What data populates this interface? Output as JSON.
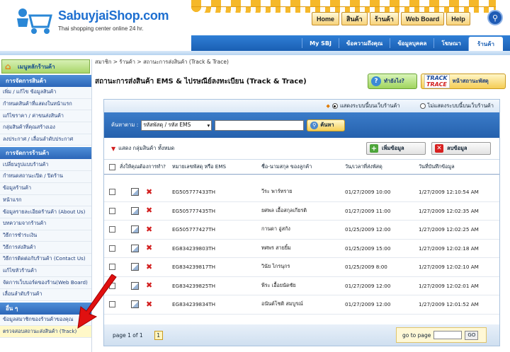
{
  "header": {
    "logo": "SabuyjaiShop.com",
    "tagline": "Thai shopping center online 24 hr.",
    "nav": [
      "Home",
      "สินค้า",
      "ร้านค้า",
      "Web Board",
      "Help"
    ],
    "bluebar": [
      "My SBJ",
      "ข้อความถึงคุณ",
      "ข้อมูลบุคคล",
      "โฆษณา",
      "ร้านค้า"
    ]
  },
  "sidebar": {
    "home": "เมนูหลักร้านค้า",
    "section1": "การจัดการสินค้า",
    "section1_items": [
      "เพิ่ม / แก้ไข ข้อมูลสินค้า",
      "กำหนดสินค้าที่แสดงในหน้าแรก",
      "แก้ไขราคา / ค่าขนส่งสินค้า",
      "กลุ่มสินค้าที่คุณสร้างเอง",
      "ลงประกาศ / เลื่อนลำดับประกาศ"
    ],
    "section2": "การจัดการร้านค้า",
    "section2_items": [
      "เปลี่ยนรูปแบบร้านค้า",
      "กำหนดสถานะเปิด / ปิดร้าน",
      "ข้อมูลร้านค้า",
      "หน้าแรก",
      "ข้อมูลรายละเอียดร้านค้า (About Us)",
      "บทความจากร้านค้า",
      "วิธีการชำระเงิน",
      "วิธีการส่งสินค้า",
      "วิธีการติดต่อกับร้านค้า (Contact Us)",
      "แก้ไขหัวร้านค้า",
      "จัดการเว็บบอร์ดของร้าน(Web Board)",
      "เลื่อนลำดับร้านค้า"
    ],
    "section3": "อื่น ๆ",
    "section3_items": [
      "ข้อมูลสมาชิกของร้านค้าของคุณ",
      "ตรวจสอบสถานะส่งสินค้า (Track)"
    ]
  },
  "main": {
    "breadcrumb": "สมาชิก > ร้านค้า > สถานะการส่งสินค้า (Track & Trace)",
    "title": "สถานะการส่งสินค้า EMS & ไปรษณีย์ลงทะเบียน (Track & Trace)",
    "help_label": "ทำยังไง?",
    "track_logo_top": "TRACK",
    "track_logo_bottom": "TRACE",
    "track_label": "หน้าสถานะพัสดุ",
    "radio_show": "แสดงระบบนี้บนเว็บร้านค้า",
    "radio_hide": "ไม่แสดงระบบนี้บนเว็บร้านค้า",
    "search_label": "ค้นหาตาม :",
    "search_select": "รหัสพัสดุ / รหัส EMS",
    "search_button": "ค้นหา",
    "group_label": "แสดง กลุ่มสินค้า ทั้งหมด",
    "add_button": "เพิ่มข้อมูล",
    "delete_button": "ลบข้อมูล",
    "columns": [
      "สั่งให้คุณต้องการทำ?",
      "หมายเลขพัสดุ หรือ EMS",
      "ชื่อ-นามสกุล ของลูกค้า",
      "วัน/เวลาที่ส่งพัสดุ",
      "วันที่บันทึกข้อมูล"
    ],
    "rows": [
      {
        "tracking": "EG505777433TH",
        "name": "วีระ พาร์ทราย",
        "sent": "01/27/2009 10:00",
        "recorded": "1/27/2009 12:10:54 AM"
      },
      {
        "tracking": "EG505777435TH",
        "name": "ยศพล เอื้อสกุลเกียรติ",
        "sent": "01/27/2009 11:00",
        "recorded": "1/27/2009 12:02:35 AM"
      },
      {
        "tracking": "EG505777427TH",
        "name": "กานดา อู่สกัง",
        "sent": "01/25/2009 12:00",
        "recorded": "1/27/2009 12:02:25 AM"
      },
      {
        "tracking": "EG834239803TH",
        "name": "ทศพร สายยิ้ม",
        "sent": "01/25/2009 15:00",
        "recorded": "1/27/2009 12:02:18 AM"
      },
      {
        "tracking": "EG834239817TH",
        "name": "วินัย ไกรนุกร",
        "sent": "01/25/2009 8:00",
        "recorded": "1/27/2009 12:02:10 AM"
      },
      {
        "tracking": "EG834239825TH",
        "name": "พีระ เอื้อยนัดชัย",
        "sent": "01/27/2009 12:00",
        "recorded": "1/27/2009 12:02:01 AM"
      },
      {
        "tracking": "EG834239834TH",
        "name": "อนันต์โชติ สมบูรณ์",
        "sent": "01/27/2009 12:00",
        "recorded": "1/27/2009 12:01:52 AM"
      }
    ],
    "page_info": "page 1 of 1",
    "page_number": "1",
    "goto_label": "go to page",
    "goto_button": "GO"
  }
}
